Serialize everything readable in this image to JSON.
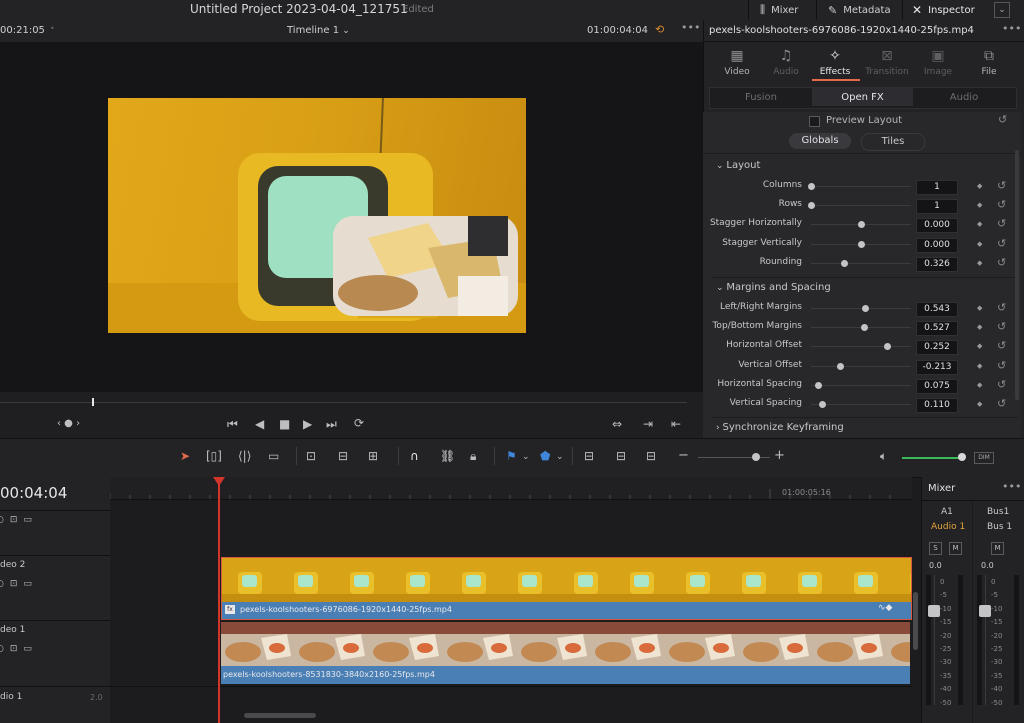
{
  "app": {
    "project_title": "Untitled Project 2023-04-04_121751",
    "project_status": "Edited",
    "top_buttons": [
      {
        "label": "Mixer",
        "icon": "mixer-icon"
      },
      {
        "label": "Metadata",
        "icon": "metadata-icon"
      },
      {
        "label": "Inspector",
        "icon": "inspector-icon"
      }
    ]
  },
  "viewer": {
    "left_timecode": "00:21:05",
    "timeline_name": "Timeline 1",
    "timecode": "01:00:04:04"
  },
  "inspector": {
    "filename": "pexels-koolshooters-6976086-1920x1440-25fps.mp4",
    "tabs": [
      "Video",
      "Audio",
      "Effects",
      "Transition",
      "Image",
      "File"
    ],
    "active_tab": "Effects",
    "subtabs": [
      "Fusion",
      "Open FX",
      "Audio"
    ],
    "preview_layout": "Preview Layout",
    "mode_buttons": [
      "Globals",
      "Tiles"
    ],
    "layout_section": "Layout",
    "layout_params": [
      {
        "label": "Columns",
        "value": "1",
        "pos": 0.0
      },
      {
        "label": "Rows",
        "value": "1",
        "pos": 0.0
      },
      {
        "label": "Stagger Horizontally",
        "value": "0.000",
        "pos": 0.5
      },
      {
        "label": "Stagger Vertically",
        "value": "0.000",
        "pos": 0.5
      },
      {
        "label": "Rounding",
        "value": "0.326",
        "pos": 0.33
      }
    ],
    "margins_section": "Margins and Spacing",
    "margin_params": [
      {
        "label": "Left/Right Margins",
        "value": "0.543",
        "pos": 0.54
      },
      {
        "label": "Top/Bottom Margins",
        "value": "0.527",
        "pos": 0.53
      },
      {
        "label": "Horizontal Offset",
        "value": "0.252",
        "pos": 0.76
      },
      {
        "label": "Vertical Offset",
        "value": "-0.213",
        "pos": 0.29
      },
      {
        "label": "Horizontal Spacing",
        "value": "0.075",
        "pos": 0.07
      },
      {
        "label": "Vertical Spacing",
        "value": "0.110",
        "pos": 0.11
      }
    ],
    "sync_section": "Synchronize Keyframing"
  },
  "timeline": {
    "timecode": "00:04:04",
    "ruler_time": "01:00:05:16",
    "tracks": [
      {
        "label": "deo 2"
      },
      {
        "label": "deo 1"
      },
      {
        "label": "dio 1",
        "level": "2.0"
      }
    ],
    "clips": {
      "v2": "pexels-koolshooters-6976086-1920x1440-25fps.mp4",
      "v1": "pexels-koolshooters-8531830-3840x2160-25fps.mp4"
    }
  },
  "mixer": {
    "title": "Mixer",
    "channels": [
      "A1",
      "Bus1"
    ],
    "channel_sub": [
      "Audio 1",
      "Bus 1"
    ],
    "solo": "S",
    "mute": "M",
    "level": "0.0",
    "scale": [
      "0",
      "-5",
      "-10",
      "-15",
      "-20",
      "-25",
      "-30",
      "-35",
      "-40",
      "-50"
    ]
  },
  "colors": {
    "accent": "#e36a4b",
    "playhead": "#d2362b",
    "clip_blue": "#4a7fb5",
    "clip_border": "#d9573a"
  }
}
